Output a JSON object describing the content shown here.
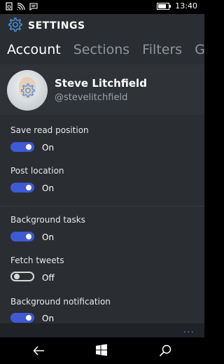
{
  "status_bar": {
    "time": "13:40",
    "icons": [
      "notification-icon",
      "wifi-icon",
      "message-icon",
      "battery-icon"
    ]
  },
  "app": {
    "title": "SETTINGS",
    "title_icon": "gear-icon",
    "accent_color": "#3f5ad6"
  },
  "tabs": [
    {
      "label": "Account",
      "active": true
    },
    {
      "label": "Sections",
      "active": false
    },
    {
      "label": "Filters",
      "active": false
    },
    {
      "label": "Gest",
      "active": false
    }
  ],
  "profile": {
    "name": "Steve Litchfield",
    "handle": "@stevelitchfield"
  },
  "settings": [
    {
      "label": "Save read position",
      "state": "On",
      "on": true
    },
    {
      "label": "Post location",
      "state": "On",
      "on": true
    },
    {
      "label": "Background tasks",
      "state": "On",
      "on": true
    },
    {
      "label": "Fetch tweets",
      "state": "Off",
      "on": false
    },
    {
      "label": "Background notification",
      "state": "On",
      "on": true
    }
  ],
  "appbar": {
    "more_label": "..."
  },
  "navbar": {
    "icons": [
      "back-icon",
      "windows-start-icon",
      "search-icon"
    ]
  }
}
